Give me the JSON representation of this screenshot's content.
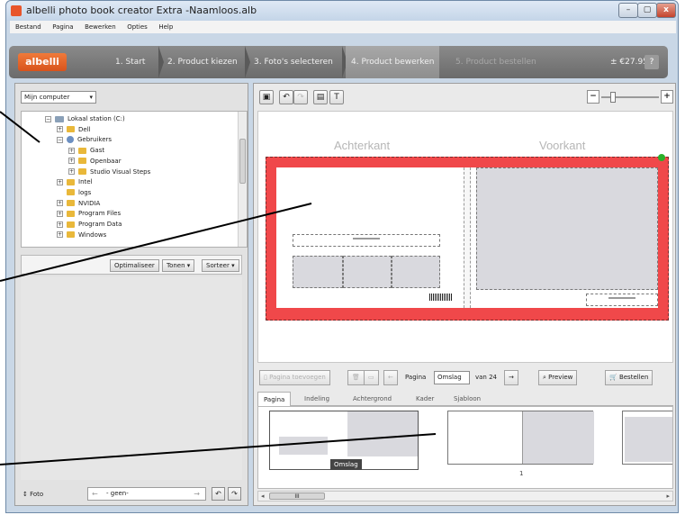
{
  "window": {
    "title": "albelli photo book creator Extra -Naamloos.alb",
    "controls": {
      "minimize": "–",
      "maximize": "▢",
      "close": "x"
    }
  },
  "menu": [
    "Bestand",
    "Pagina",
    "Bewerken",
    "Opties",
    "Help"
  ],
  "stepbar": {
    "logo": "albelli",
    "steps": [
      "1. Start",
      "2. Product kiezen",
      "3. Foto's selecteren",
      "4. Product bewerken",
      "5. Product bestellen"
    ],
    "active_step": 3,
    "price": "± €27.95",
    "help": "?"
  },
  "left": {
    "source_select": "Mijn computer",
    "tree": [
      {
        "label": "Lokaal station (C:)",
        "level": 0,
        "expander": "−",
        "icon": "drive-icon"
      },
      {
        "label": "Dell",
        "level": 1,
        "expander": "+",
        "icon": "folder-icon"
      },
      {
        "label": "Gebruikers",
        "level": 1,
        "expander": "−",
        "icon": "user-folder-icon"
      },
      {
        "label": "Gast",
        "level": 2,
        "expander": "+",
        "icon": "folder-icon"
      },
      {
        "label": "Openbaar",
        "level": 2,
        "expander": "+",
        "icon": "folder-icon"
      },
      {
        "label": "Studio Visual Steps",
        "level": 2,
        "expander": "+",
        "icon": "folder-icon"
      },
      {
        "label": "Intel",
        "level": 1,
        "expander": "+",
        "icon": "folder-icon"
      },
      {
        "label": "logs",
        "level": 1,
        "expander": "",
        "icon": "folder-icon"
      },
      {
        "label": "NVIDIA",
        "level": 1,
        "expander": "+",
        "icon": "folder-icon"
      },
      {
        "label": "Program Files",
        "level": 1,
        "expander": "+",
        "icon": "folder-icon"
      },
      {
        "label": "Program Data",
        "level": 1,
        "expander": "+",
        "icon": "folder-icon"
      },
      {
        "label": "Windows",
        "level": 1,
        "expander": "+",
        "icon": "folder-icon"
      }
    ],
    "toolbar": {
      "optimize": "Optimaliseer",
      "show": "Tonen",
      "sort": "Sorteer"
    },
    "foto_label": "Foto",
    "foto_value": "- geen-"
  },
  "editor": {
    "label_back": "Achterkant",
    "label_front": "Voorkant",
    "colors": {
      "spread": "#f0484a",
      "photo_slot": "#d9d9de",
      "marker": "#2ab02a"
    }
  },
  "page_nav": {
    "add_pages": "Pagina toevoegen",
    "page_label": "Pagina",
    "page_value": "Omslag",
    "page_count": "van 24",
    "preview": "Preview",
    "order": "Bestellen"
  },
  "tabs": [
    "Pagina",
    "Indeling",
    "Achtergrond",
    "Kader",
    "Sjabloon"
  ],
  "thumbnails": {
    "cover_tag": "Omslag",
    "page_number": "1",
    "scroll_thumb": "III"
  }
}
